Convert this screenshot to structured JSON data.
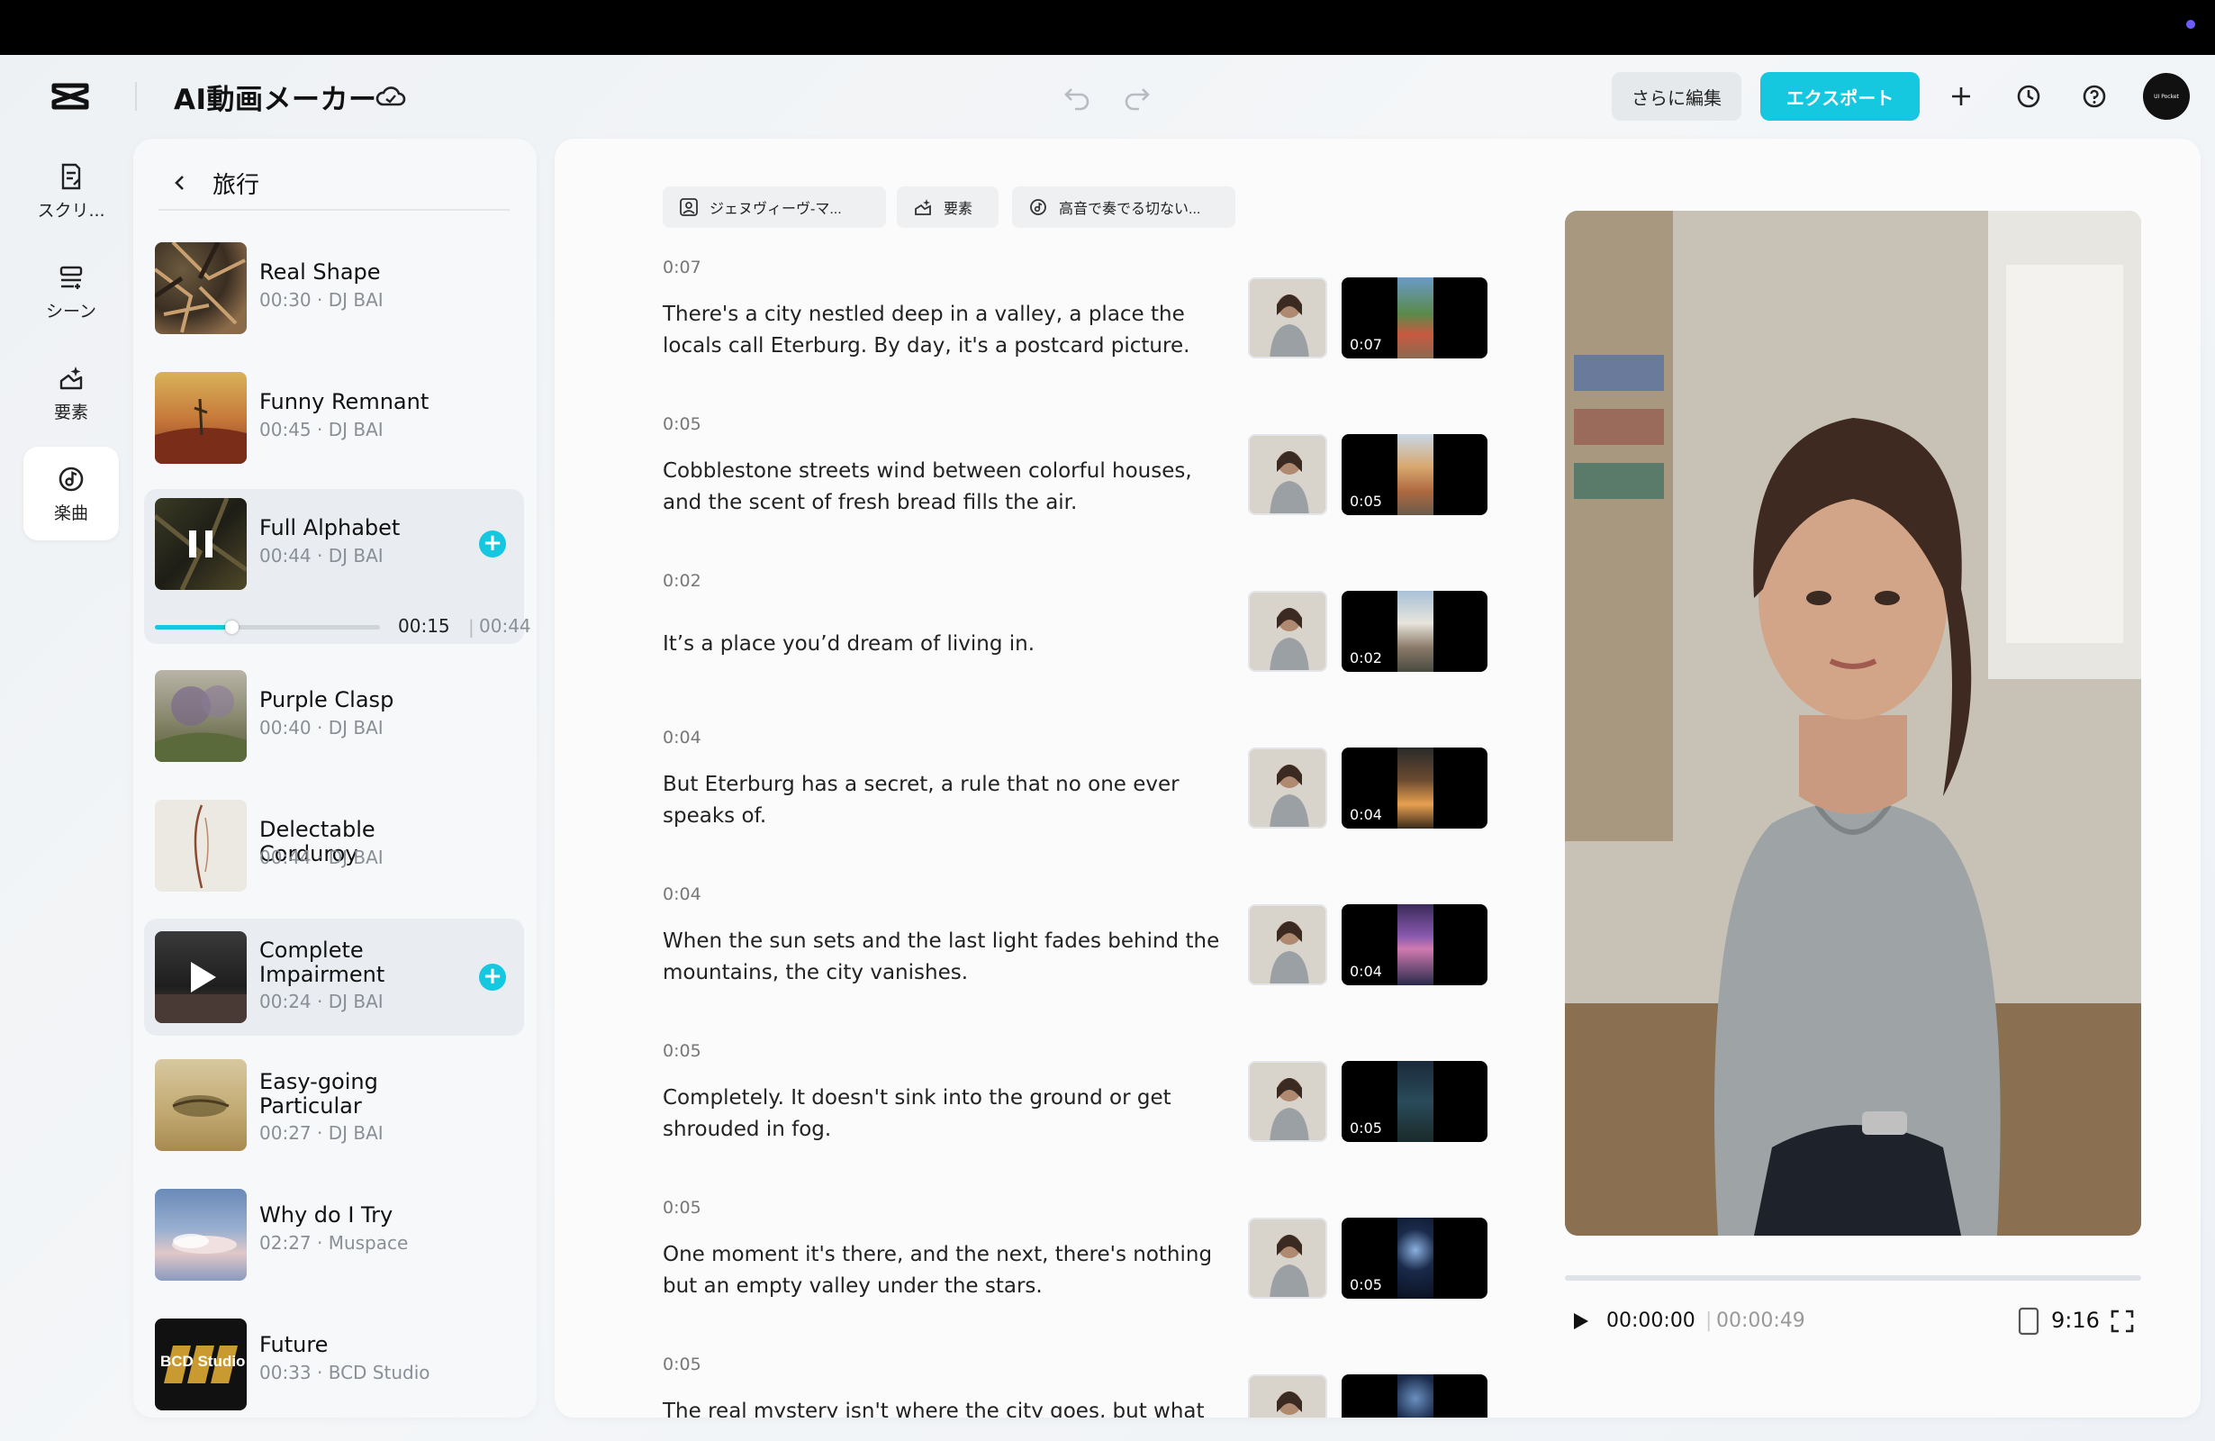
{
  "header": {
    "title": "AI動画メーカー",
    "edit_label": "さらに編集",
    "export_label": "エクスポート",
    "avatar_text": "UI Pocket"
  },
  "colors": {
    "accent": "#16c7e0",
    "topbar": "#000000",
    "status_dot": "#6b5cff"
  },
  "nav": [
    {
      "label": "スクリ...",
      "icon": "script-icon"
    },
    {
      "label": "シーン",
      "icon": "scene-icon"
    },
    {
      "label": "要素",
      "icon": "elements-icon"
    },
    {
      "label": "楽曲",
      "icon": "music-icon",
      "active": true
    }
  ],
  "music": {
    "title": "旅行",
    "tracks": [
      {
        "title": "Real Shape",
        "meta": "00:30 · DJ BAI"
      },
      {
        "title": "Funny Remnant",
        "meta": "00:45 · DJ BAI"
      },
      {
        "title": "Full Alphabet",
        "meta": "00:44 · DJ BAI",
        "playing": true,
        "current": "00:15",
        "total": "00:44",
        "progress": 0.34
      },
      {
        "title": "Purple Clasp",
        "meta": "00:40 · DJ BAI"
      },
      {
        "title": "Delectable Corduroy",
        "meta": "00:44 · DJ BAI"
      },
      {
        "title": "Complete Impairment",
        "meta": "00:24 · DJ BAI",
        "selected": true
      },
      {
        "title": "Easy-going Particular",
        "meta": "00:27 · DJ BAI"
      },
      {
        "title": "Why do I Try",
        "meta": "02:27 · Muspace"
      },
      {
        "title": "Future",
        "meta": "00:33 · BCD Studio",
        "thumb_text": "BCD Studio"
      }
    ]
  },
  "chips": [
    {
      "label": "ジェヌヴィーヴ-マ..."
    },
    {
      "label": "要素"
    },
    {
      "label": "高音で奏でる切ない..."
    }
  ],
  "scenes": [
    {
      "time": "0:07",
      "text": "There's a city nestled deep in a valley, a place the locals call Eterburg. By day, it's a postcard picture.",
      "duration": "0:07"
    },
    {
      "time": "0:05",
      "text": "Cobblestone streets wind between colorful houses, and the scent of fresh bread fills the air.",
      "duration": "0:05"
    },
    {
      "time": "0:02",
      "text": "It’s a place you’d dream of living in.",
      "duration": "0:02"
    },
    {
      "time": "0:04",
      "text": "But Eterburg has a secret, a rule that no one ever speaks of.",
      "duration": "0:04"
    },
    {
      "time": "0:04",
      "text": "When the sun sets and the last light fades behind the mountains, the city vanishes.",
      "duration": "0:04"
    },
    {
      "time": "0:05",
      "text": "Completely. It doesn't sink into the ground or get shrouded in fog.",
      "duration": "0:05"
    },
    {
      "time": "0:05",
      "text": "One moment it's there, and the next, there's nothing but an empty valley under the stars.",
      "duration": "0:05"
    },
    {
      "time": "0:05",
      "text": "The real mystery isn't where the city goes, but what",
      "duration": ""
    }
  ],
  "preview": {
    "current": "00:00:00",
    "total": "00:00:49",
    "ratio": "9:16",
    "progress": 0
  }
}
